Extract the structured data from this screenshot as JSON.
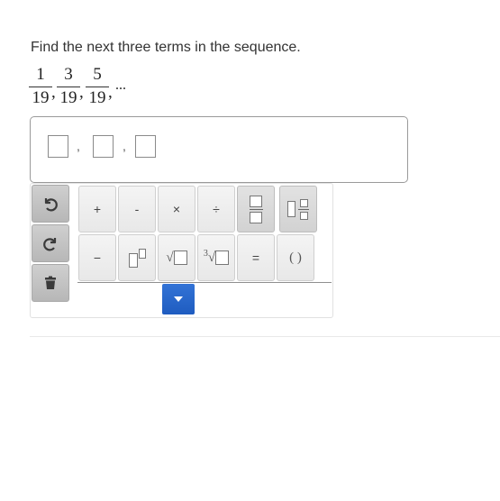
{
  "question": {
    "prompt": "Find the next three terms in the sequence."
  },
  "sequence": {
    "terms": [
      {
        "numerator": "1",
        "denominator": "19"
      },
      {
        "numerator": "3",
        "denominator": "19"
      },
      {
        "numerator": "5",
        "denominator": "19"
      }
    ],
    "separator": ",",
    "ellipsis": "..."
  },
  "answer": {
    "slots": 3,
    "separator": ","
  },
  "palette": {
    "keys_row1": [
      {
        "label": "+",
        "icon": "plus-icon"
      },
      {
        "label": "-",
        "icon": "minus-icon"
      },
      {
        "label": "×",
        "icon": "times-icon"
      },
      {
        "label": "÷",
        "icon": "divide-icon"
      }
    ],
    "keys_row2": [
      {
        "label": "−",
        "icon": "negative-icon"
      },
      {
        "label": "√",
        "icon": "square-root-icon"
      },
      {
        "label": "3",
        "icon": "cube-root-icon"
      },
      {
        "label": "=",
        "icon": "equals-icon"
      },
      {
        "label": "( )",
        "icon": "parentheses-icon"
      }
    ],
    "side_buttons": [
      "undo-icon",
      "redo-icon",
      "trash-icon"
    ],
    "expand_icon": "caret-down-icon",
    "accent_color": "#2a67cc"
  }
}
